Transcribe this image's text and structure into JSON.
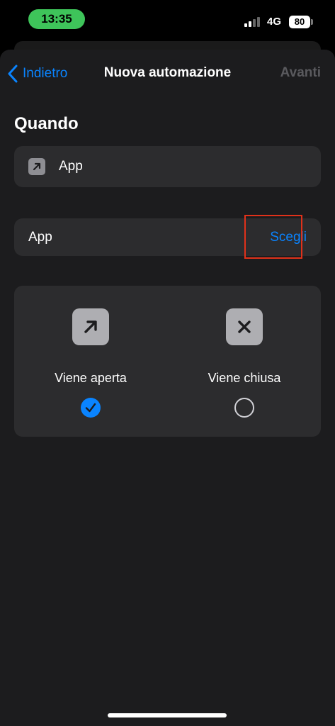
{
  "status_bar": {
    "time": "13:35",
    "network": "4G",
    "battery": "80"
  },
  "nav": {
    "back_label": "Indietro",
    "title": "Nuova automazione",
    "next_label": "Avanti"
  },
  "section": {
    "title": "Quando"
  },
  "trigger": {
    "label": "App",
    "icon": "arrow-up-right-icon"
  },
  "app_selector": {
    "label": "App",
    "choose_label": "Scegli"
  },
  "options": [
    {
      "label": "Viene aperta",
      "icon": "arrow-up-right-icon",
      "selected": true
    },
    {
      "label": "Viene chiusa",
      "icon": "close-icon",
      "selected": false
    }
  ],
  "colors": {
    "accent": "#0a84ff",
    "time_pill": "#3ec45a",
    "highlight": "#e0311a"
  }
}
